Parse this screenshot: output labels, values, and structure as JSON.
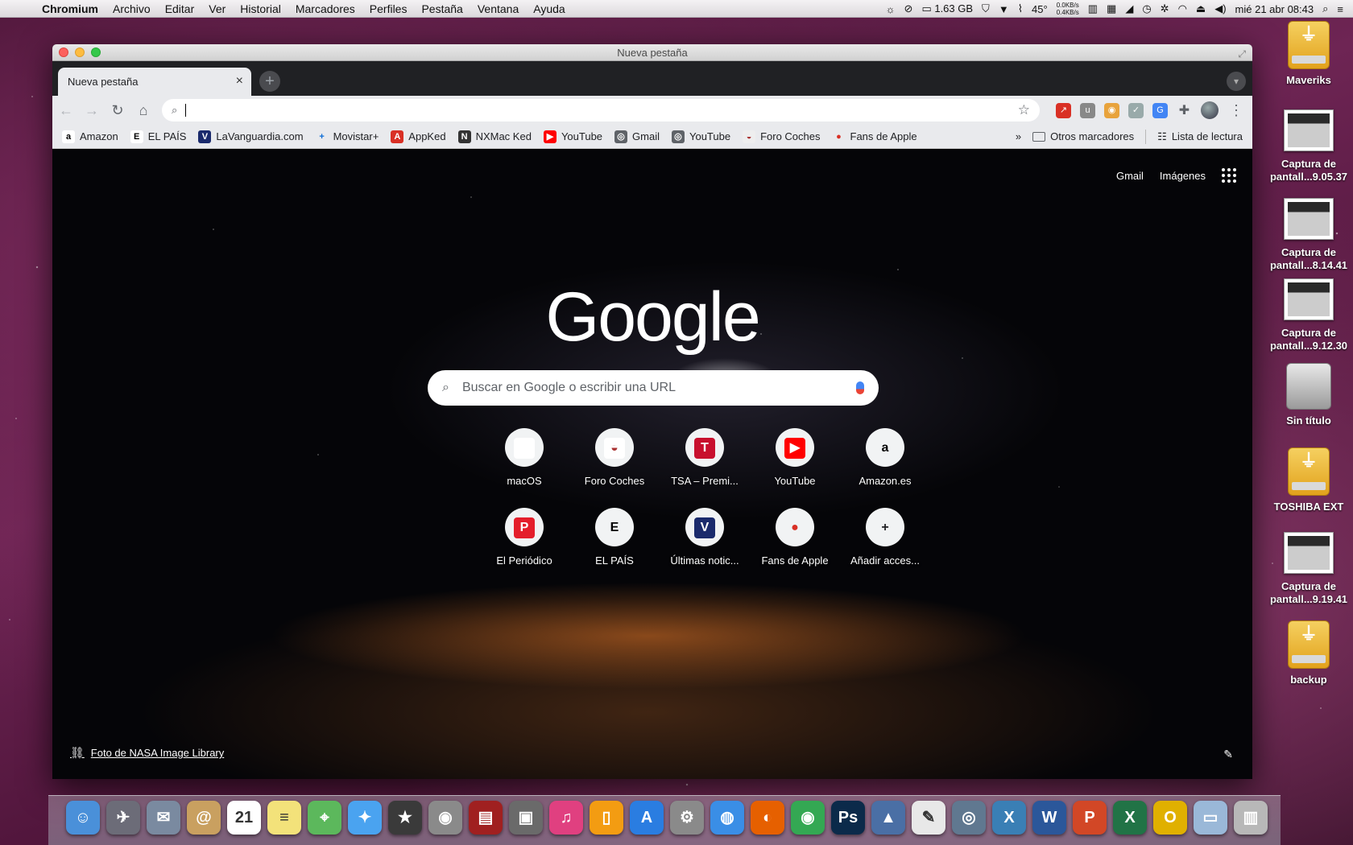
{
  "menubar": {
    "apple_icon": "apple-icon",
    "items": [
      "Chromium",
      "Archivo",
      "Editar",
      "Ver",
      "Historial",
      "Marcadores",
      "Perfiles",
      "Pestaña",
      "Ventana",
      "Ayuda"
    ],
    "status": {
      "memory": "1.63 GB",
      "temperature": "45°",
      "net_up": "0.0KB/s",
      "net_down": "0.4KB/s",
      "clock": "mié 21 abr  08:43"
    }
  },
  "desktop": {
    "icons": [
      {
        "label": "Maveriks",
        "kind": "usb-drive"
      },
      {
        "label": "Captura de pantall...9.05.37",
        "kind": "screenshot"
      },
      {
        "label": "Captura de pantall...8.14.41",
        "kind": "screenshot"
      },
      {
        "label": "Captura de pantall...9.12.30",
        "kind": "screenshot"
      },
      {
        "label": "Sin título",
        "kind": "hard-disk"
      },
      {
        "label": "TOSHIBA EXT",
        "kind": "usb-drive"
      },
      {
        "label": "Captura de pantall...9.19.41",
        "kind": "screenshot"
      },
      {
        "label": "backup",
        "kind": "usb-drive"
      }
    ]
  },
  "window": {
    "title": "Nueva pestaña",
    "tab": {
      "title": "Nueva pestaña",
      "close": "×"
    },
    "newtab_label": "+",
    "omnibox": {
      "value": "",
      "placeholder": ""
    },
    "bookmarks": [
      {
        "label": "Amazon",
        "fav": "a",
        "bg": "#ffffff",
        "fg": "#000000"
      },
      {
        "label": "EL PAÍS",
        "fav": "E",
        "bg": "#ffffff",
        "fg": "#000000"
      },
      {
        "label": "LaVanguardia.com",
        "fav": "V",
        "bg": "#1a2a6c",
        "fg": "#ffffff"
      },
      {
        "label": "Movistar+",
        "fav": "+",
        "bg": "transparent",
        "fg": "#0b6cd6"
      },
      {
        "label": "AppKed",
        "fav": "A",
        "bg": "#d93025",
        "fg": "#ffffff"
      },
      {
        "label": "NXMac Ked",
        "fav": "N",
        "bg": "#333333",
        "fg": "#ffffff"
      },
      {
        "label": "YouTube",
        "fav": "▶",
        "bg": "#ff0000",
        "fg": "#ffffff"
      },
      {
        "label": "Gmail",
        "fav": "◎",
        "bg": "#5f6368",
        "fg": "#ffffff"
      },
      {
        "label": "YouTube",
        "fav": "◎",
        "bg": "#5f6368",
        "fg": "#ffffff"
      },
      {
        "label": "Foro Coches",
        "fav": "◒",
        "bg": "#eeeeee",
        "fg": "#a33"
      },
      {
        "label": "Fans de Apple",
        "fav": "●",
        "bg": "transparent",
        "fg": "#d93025"
      }
    ],
    "bookmarks_overflow": "»",
    "other_bookmarks": "Otros marcadores",
    "reading_list": "Lista de lectura"
  },
  "ntp": {
    "links": {
      "gmail": "Gmail",
      "images": "Imágenes"
    },
    "logo": "Google",
    "search_placeholder": "Buscar en Google o escribir una URL",
    "tiles": [
      {
        "label": "macOS",
        "icon": "",
        "bg": "#ffffff",
        "fg": "#d93025"
      },
      {
        "label": "Foro Coches",
        "icon": "◒",
        "bg": "#ffffff",
        "fg": "#a33"
      },
      {
        "label": "TSA – Premi...",
        "icon": "T",
        "bg": "#c8102e",
        "fg": "#ffffff"
      },
      {
        "label": "YouTube",
        "icon": "▶",
        "bg": "#ff0000",
        "fg": "#ffffff"
      },
      {
        "label": "Amazon.es",
        "icon": "a",
        "bg": "transparent",
        "fg": "#000000"
      },
      {
        "label": "El Periódico",
        "icon": "P",
        "bg": "#e41e2b",
        "fg": "#ffffff"
      },
      {
        "label": "EL PAÍS",
        "icon": "E",
        "bg": "transparent",
        "fg": "#000000"
      },
      {
        "label": "Últimas notic...",
        "icon": "V",
        "bg": "#1a2a6c",
        "fg": "#ffffff"
      },
      {
        "label": "Fans de Apple",
        "icon": "●",
        "bg": "transparent",
        "fg": "#d93025"
      },
      {
        "label": "Añadir acces...",
        "icon": "+",
        "bg": "transparent",
        "fg": "#202124"
      }
    ],
    "attribution": "Foto de NASA Image Library",
    "customize_icon": "pencil-icon"
  },
  "dock": {
    "apps": [
      {
        "name": "finder-icon",
        "glyph": "☺",
        "bg": "#4a90d9"
      },
      {
        "name": "launchpad-icon",
        "glyph": "✈",
        "bg": "#6c6c78"
      },
      {
        "name": "mail-stamp-icon",
        "glyph": "✉",
        "bg": "#7a8aa0"
      },
      {
        "name": "contacts-icon",
        "glyph": "@",
        "bg": "#c9a060"
      },
      {
        "name": "calendar-icon",
        "glyph": "21",
        "bg": "#ffffff"
      },
      {
        "name": "notes-icon",
        "glyph": "≡",
        "bg": "#f3e27a"
      },
      {
        "name": "maps-icon",
        "glyph": "⌖",
        "bg": "#5cb85c"
      },
      {
        "name": "messages-icon",
        "glyph": "✦",
        "bg": "#4aa3f0"
      },
      {
        "name": "imovie-icon",
        "glyph": "★",
        "bg": "#3a3a3a"
      },
      {
        "name": "photo-booth-icon",
        "glyph": "◉",
        "bg": "#8a8a8a"
      },
      {
        "name": "dvd-player-icon",
        "glyph": "▤",
        "bg": "#a02020"
      },
      {
        "name": "image-capture-icon",
        "glyph": "▣",
        "bg": "#6a6a6a"
      },
      {
        "name": "itunes-icon",
        "glyph": "♫",
        "bg": "#e04080"
      },
      {
        "name": "ibooks-icon",
        "glyph": "▯",
        "bg": "#f39c12"
      },
      {
        "name": "app-store-icon",
        "glyph": "A",
        "bg": "#2a7de1"
      },
      {
        "name": "system-preferences-icon",
        "glyph": "⚙",
        "bg": "#8a8a8a"
      },
      {
        "name": "safari-icon",
        "glyph": "◍",
        "bg": "#3a8ee6"
      },
      {
        "name": "firefox-icon",
        "glyph": "◐",
        "bg": "#e66000"
      },
      {
        "name": "chrome-icon",
        "glyph": "◉",
        "bg": "#34a853"
      },
      {
        "name": "photoshop-icon",
        "glyph": "Ps",
        "bg": "#0b2a4a"
      },
      {
        "name": "keynote-icon",
        "glyph": "▲",
        "bg": "#4a6fa5"
      },
      {
        "name": "textedit-icon",
        "glyph": "✎",
        "bg": "#e8e8e8"
      },
      {
        "name": "dvd-burner-icon",
        "glyph": "◎",
        "bg": "#607890"
      },
      {
        "name": "x-app-icon",
        "glyph": "X",
        "bg": "#3a7fb5"
      },
      {
        "name": "word-icon",
        "glyph": "W",
        "bg": "#2b579a"
      },
      {
        "name": "powerpoint-icon",
        "glyph": "P",
        "bg": "#d24726"
      },
      {
        "name": "excel-icon",
        "glyph": "X",
        "bg": "#217346"
      },
      {
        "name": "outlook-icon",
        "glyph": "O",
        "bg": "#e0b000"
      },
      {
        "name": "downloads-folder-icon",
        "glyph": "▭",
        "bg": "#9ab8d8"
      },
      {
        "name": "trash-icon",
        "glyph": "▥",
        "bg": "#b8b8b8"
      }
    ]
  }
}
